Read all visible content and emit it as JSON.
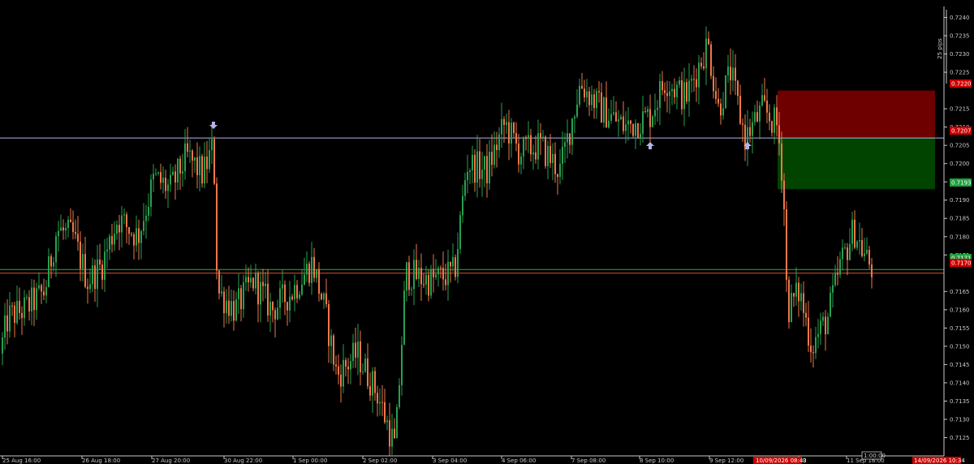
{
  "chart_data": {
    "type": "candlestick",
    "title": "",
    "xlabel": "",
    "ylabel": "",
    "ylim": [
      0.712,
      0.7243
    ],
    "y_ticks": [
      "0.7240",
      "0.7235",
      "0.7230",
      "0.7225",
      "0.7215",
      "0.7210",
      "0.7205",
      "0.7200",
      "0.7195",
      "0.7190",
      "0.7185",
      "0.7180",
      "0.7175",
      "0.7165",
      "0.7160",
      "0.7155",
      "0.7150",
      "0.7145",
      "0.7140",
      "0.7135",
      "0.7130",
      "0.7125"
    ],
    "x_labels": [
      "25 Aug 16:00",
      "26 Aug 18:00",
      "27 Aug 20:00",
      "30 Aug 22:00",
      "1 Sep 00:00",
      "2 Sep 02:00",
      "3 Sep 04:00",
      "4 Sep 06:00",
      "7 Sep 08:00",
      "8 Sep 10:00",
      "9 Sep 12:00",
      "00",
      "11 Sep 16:00"
    ],
    "scale_label": "25 pips",
    "time_box_label": "1:00:00",
    "price_tags": {
      "stop_loss": "0.7220",
      "entry": "0.7207",
      "take_profit": "0.7193",
      "line_green": "0.7171",
      "current": "0.7170"
    },
    "date_tags": [
      "10/09/2026 08:43",
      "14/09/2026 10:34"
    ],
    "horizontal_lines": [
      {
        "price": 0.7207,
        "color": "#b4b4e6"
      },
      {
        "price": 0.7171,
        "color": "#2fa64e"
      },
      {
        "price": 0.717,
        "color": "#e05030"
      }
    ],
    "zones": [
      {
        "kind": "stop-loss",
        "top": 0.722,
        "bottom": 0.7207,
        "start_label": "10/09/2026 08:43",
        "color": "#6e0000"
      },
      {
        "kind": "take-profit",
        "top": 0.7207,
        "bottom": 0.7193,
        "start_label": "10/09/2026 08:43",
        "color": "#004400"
      }
    ],
    "markers": [
      {
        "kind": "down-arrow",
        "label": "27 Aug 20:00",
        "price": 0.7209
      },
      {
        "kind": "up-arrow",
        "label": "8 Sep 10:00",
        "price": 0.7201
      },
      {
        "kind": "up-arrow",
        "label": "9 Sep 12:00",
        "price": 0.7201
      }
    ],
    "anchors": [
      {
        "t": 0,
        "p": 0.7148
      },
      {
        "t": 10,
        "p": 0.7158
      },
      {
        "t": 30,
        "p": 0.716
      },
      {
        "t": 55,
        "p": 0.7165
      },
      {
        "t": 70,
        "p": 0.7182
      },
      {
        "t": 90,
        "p": 0.718
      },
      {
        "t": 108,
        "p": 0.7168
      },
      {
        "t": 125,
        "p": 0.7172
      },
      {
        "t": 145,
        "p": 0.7185
      },
      {
        "t": 170,
        "p": 0.718
      },
      {
        "t": 190,
        "p": 0.7196
      },
      {
        "t": 210,
        "p": 0.7193
      },
      {
        "t": 230,
        "p": 0.7202
      },
      {
        "t": 250,
        "p": 0.7197
      },
      {
        "t": 263,
        "p": 0.7205
      },
      {
        "t": 268,
        "p": 0.7165
      },
      {
        "t": 290,
        "p": 0.716
      },
      {
        "t": 312,
        "p": 0.7168
      },
      {
        "t": 335,
        "p": 0.716
      },
      {
        "t": 360,
        "p": 0.7165
      },
      {
        "t": 385,
        "p": 0.7173
      },
      {
        "t": 400,
        "p": 0.716
      },
      {
        "t": 415,
        "p": 0.7142
      },
      {
        "t": 440,
        "p": 0.7148
      },
      {
        "t": 465,
        "p": 0.7137
      },
      {
        "t": 487,
        "p": 0.7122
      },
      {
        "t": 500,
        "p": 0.717
      },
      {
        "t": 530,
        "p": 0.7168
      },
      {
        "t": 560,
        "p": 0.717
      },
      {
        "t": 575,
        "p": 0.72
      },
      {
        "t": 600,
        "p": 0.7198
      },
      {
        "t": 622,
        "p": 0.7211
      },
      {
        "t": 640,
        "p": 0.7203
      },
      {
        "t": 665,
        "p": 0.7205
      },
      {
        "t": 690,
        "p": 0.7198
      },
      {
        "t": 715,
        "p": 0.7222
      },
      {
        "t": 740,
        "p": 0.7215
      },
      {
        "t": 770,
        "p": 0.721
      },
      {
        "t": 800,
        "p": 0.7213
      },
      {
        "t": 820,
        "p": 0.7223
      },
      {
        "t": 845,
        "p": 0.7218
      },
      {
        "t": 872,
        "p": 0.7233
      },
      {
        "t": 885,
        "p": 0.7215
      },
      {
        "t": 900,
        "p": 0.7225
      },
      {
        "t": 918,
        "p": 0.7207
      },
      {
        "t": 940,
        "p": 0.7215
      },
      {
        "t": 958,
        "p": 0.721
      },
      {
        "t": 965,
        "p": 0.7195
      },
      {
        "t": 970,
        "p": 0.716
      },
      {
        "t": 985,
        "p": 0.7165
      },
      {
        "t": 1000,
        "p": 0.715
      },
      {
        "t": 1020,
        "p": 0.7158
      },
      {
        "t": 1035,
        "p": 0.7172
      },
      {
        "t": 1052,
        "p": 0.7182
      },
      {
        "t": 1065,
        "p": 0.7175
      },
      {
        "t": 1075,
        "p": 0.7171
      }
    ],
    "colors": {
      "bull": "#28a050",
      "bear": "#f07848",
      "grid_axis": "#c8c8c8",
      "tag_red": "#cc0000",
      "tag_green": "#1e9e3c",
      "tag_violet": "#b4b4e6"
    }
  }
}
